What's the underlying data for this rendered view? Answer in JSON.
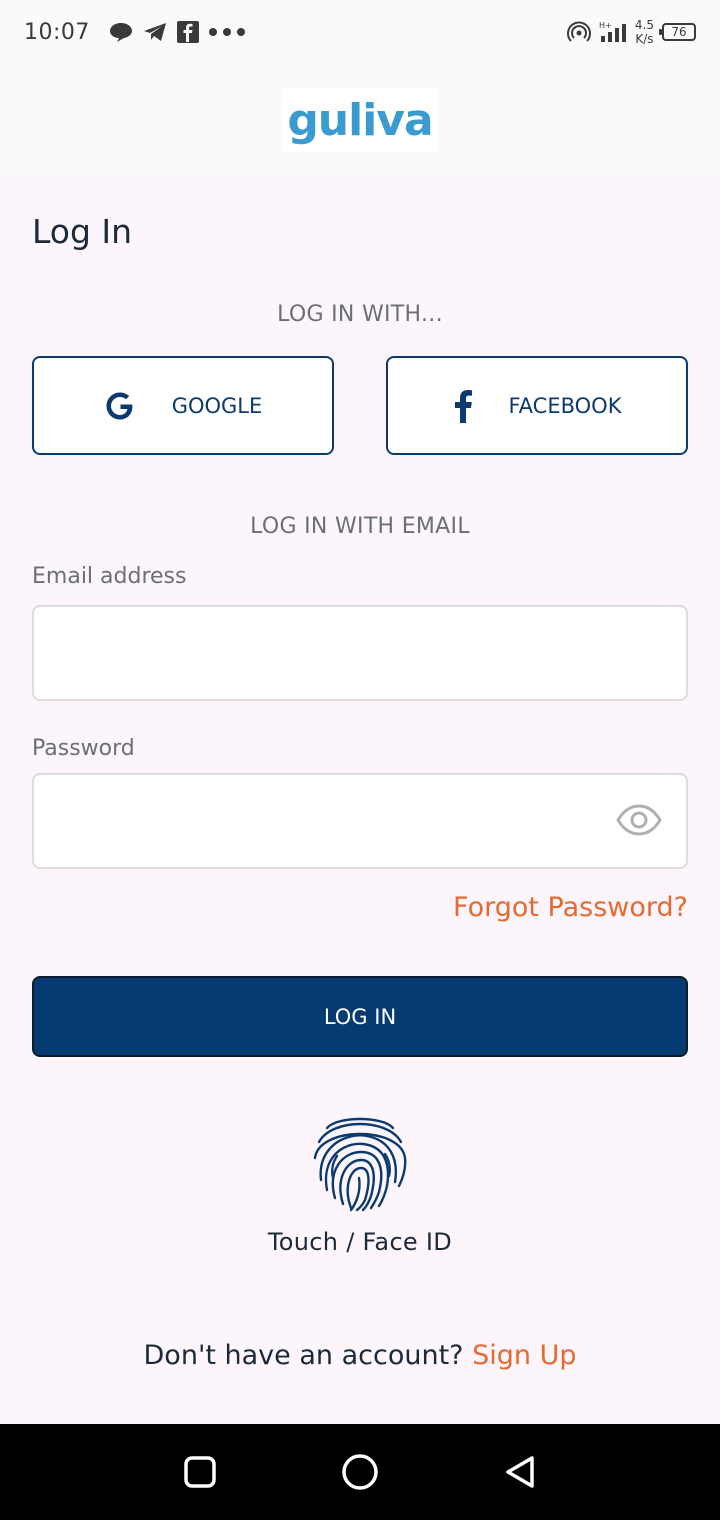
{
  "status_bar": {
    "time": "10:07",
    "speed_value": "4.5",
    "speed_unit": "K/s",
    "battery": "76"
  },
  "brand": {
    "logo_text": "guliva",
    "logo_color": "#3a9bd1"
  },
  "page": {
    "title": "Log In"
  },
  "social": {
    "section_label": "LOG IN WITH...",
    "google_label": "GOOGLE",
    "facebook_label": "FACEBOOK"
  },
  "email_section": {
    "section_label": "LOG IN WITH EMAIL",
    "email_label": "Email address",
    "email_value": "",
    "password_label": "Password",
    "password_value": ""
  },
  "actions": {
    "forgot_password": "Forgot Password?",
    "login_button": "LOG IN",
    "biometric_label": "Touch / Face ID",
    "signup_prompt": "Don't have an account?",
    "signup_link": "Sign Up"
  },
  "colors": {
    "primary": "#063a72",
    "accent": "#e8692f",
    "background": "#fcf6fc"
  },
  "icons": [
    "google-icon",
    "facebook-icon",
    "eye-icon",
    "fingerprint-icon",
    "recents-icon",
    "home-icon",
    "back-icon"
  ]
}
